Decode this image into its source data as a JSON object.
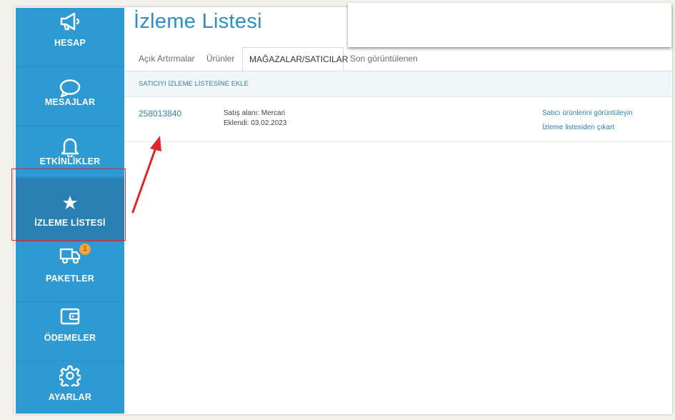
{
  "page": {
    "title": "İzleme Listesi"
  },
  "sidebar": {
    "items": [
      {
        "label": "HESAP",
        "icon": "megaphone-icon"
      },
      {
        "label": "MESAJLAR",
        "icon": "speech-bubble-icon"
      },
      {
        "label": "ETKİNLİKLER",
        "icon": "bell-icon"
      },
      {
        "label": "İZLEME LİSTESİ",
        "icon": "star-icon",
        "active": true
      },
      {
        "label": "PAKETLER",
        "icon": "truck-icon",
        "badge": "1"
      },
      {
        "label": "ÖDEMELER",
        "icon": "wallet-icon"
      },
      {
        "label": "AYARLAR",
        "icon": "gear-icon"
      }
    ]
  },
  "tabs": [
    {
      "label": "Açık Artırmalar"
    },
    {
      "label": "Ürünler"
    },
    {
      "label": "MAĞAZALAR/SATICILAR",
      "active": true
    },
    {
      "label": "Son görüntülenen"
    }
  ],
  "actions": {
    "add_seller": "SATICIYI İZLEME LİSTESİNE EKLE"
  },
  "sellers": [
    {
      "id": "258013840",
      "sales_area": "Satış alanı: Mercari",
      "added": "Eklendi: 03.02.2023",
      "view_products": "Satıcı ürünlerini görüntüleyin",
      "remove": "İzleme listesiden çıkart"
    }
  ],
  "colors": {
    "sidebar": "#2e9ad3",
    "sidebar_active": "#2a7fb3",
    "accent": "#2e8fc6",
    "annotation": "#e0262a",
    "badge": "#f5a43a"
  }
}
